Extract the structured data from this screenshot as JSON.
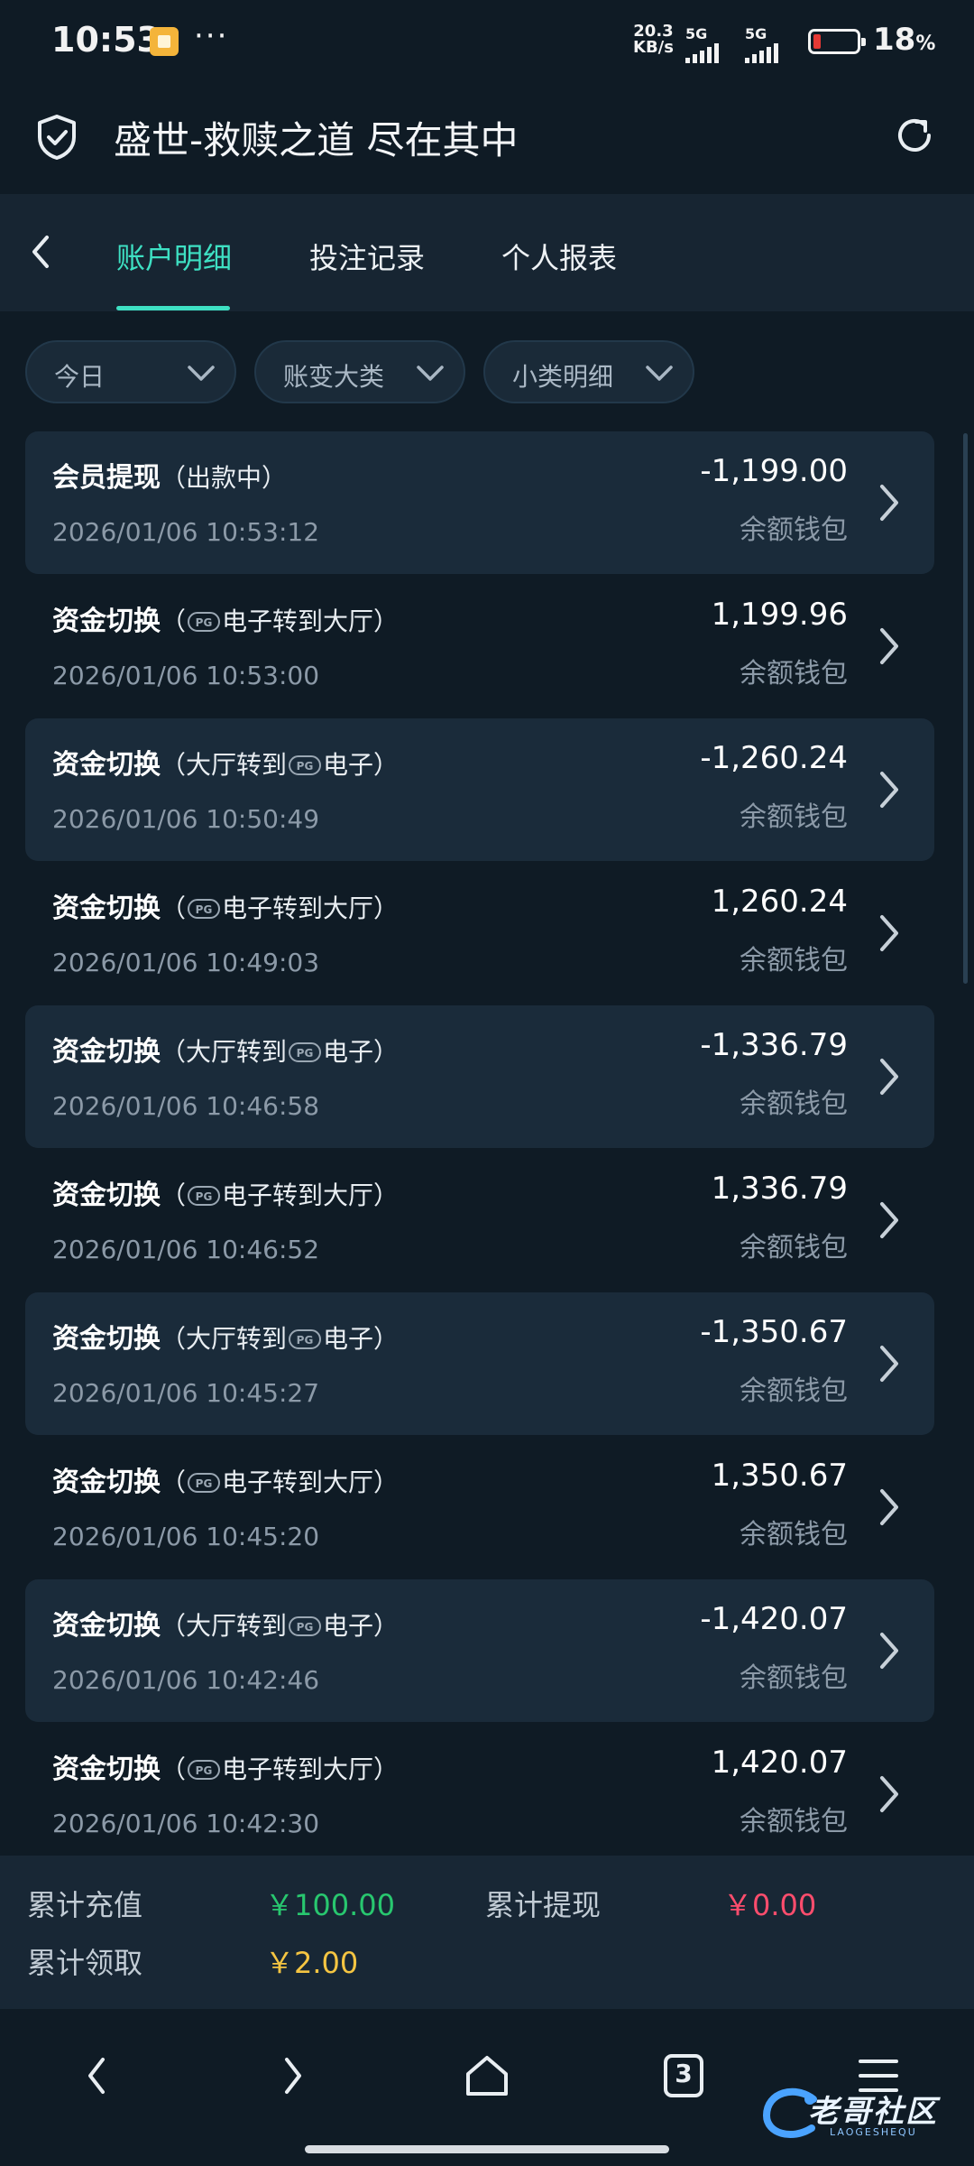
{
  "status_bar": {
    "time": "10:53",
    "more": "···",
    "net_speed_value": "20.3",
    "net_speed_unit": "KB/s",
    "signal1_label": "5G",
    "signal2_label": "5G",
    "battery_percent": "18",
    "battery_unit": "%"
  },
  "header": {
    "title": "盛世-救赎之道 尽在其中",
    "left_icon": "shield-check-icon",
    "right_icon": "refresh-icon"
  },
  "tabs": [
    {
      "label": "账户明细",
      "active": true
    },
    {
      "label": "投注记录",
      "active": false
    },
    {
      "label": "个人报表",
      "active": false
    }
  ],
  "filters": [
    {
      "label": "今日"
    },
    {
      "label": "账变大类"
    },
    {
      "label": "小类明细"
    }
  ],
  "records": [
    {
      "title": "会员提现",
      "detail_pre": "（出款中）",
      "detail_post": "",
      "has_logo": false,
      "time": "2026/01/06 10:53:12",
      "amount": "-1,199.00",
      "wallet": "余额钱包",
      "shaded": true
    },
    {
      "title": "资金切换",
      "detail_pre": "（",
      "detail_post": "电子转到大厅）",
      "has_logo": true,
      "time": "2026/01/06 10:53:00",
      "amount": "1,199.96",
      "wallet": "余额钱包",
      "shaded": false
    },
    {
      "title": "资金切换",
      "detail_pre": "（大厅转到",
      "detail_post": "电子）",
      "has_logo": true,
      "time": "2026/01/06 10:50:49",
      "amount": "-1,260.24",
      "wallet": "余额钱包",
      "shaded": true
    },
    {
      "title": "资金切换",
      "detail_pre": "（",
      "detail_post": "电子转到大厅）",
      "has_logo": true,
      "time": "2026/01/06 10:49:03",
      "amount": "1,260.24",
      "wallet": "余额钱包",
      "shaded": false
    },
    {
      "title": "资金切换",
      "detail_pre": "（大厅转到",
      "detail_post": "电子）",
      "has_logo": true,
      "time": "2026/01/06 10:46:58",
      "amount": "-1,336.79",
      "wallet": "余额钱包",
      "shaded": true
    },
    {
      "title": "资金切换",
      "detail_pre": "（",
      "detail_post": "电子转到大厅）",
      "has_logo": true,
      "time": "2026/01/06 10:46:52",
      "amount": "1,336.79",
      "wallet": "余额钱包",
      "shaded": false
    },
    {
      "title": "资金切换",
      "detail_pre": "（大厅转到",
      "detail_post": "电子）",
      "has_logo": true,
      "time": "2026/01/06 10:45:27",
      "amount": "-1,350.67",
      "wallet": "余额钱包",
      "shaded": true
    },
    {
      "title": "资金切换",
      "detail_pre": "（",
      "detail_post": "电子转到大厅）",
      "has_logo": true,
      "time": "2026/01/06 10:45:20",
      "amount": "1,350.67",
      "wallet": "余额钱包",
      "shaded": false
    },
    {
      "title": "资金切换",
      "detail_pre": "（大厅转到",
      "detail_post": "电子）",
      "has_logo": true,
      "time": "2026/01/06 10:42:46",
      "amount": "-1,420.07",
      "wallet": "余额钱包",
      "shaded": true
    },
    {
      "title": "资金切换",
      "detail_pre": "（",
      "detail_post": "电子转到大厅）",
      "has_logo": true,
      "time": "2026/01/06 10:42:30",
      "amount": "1,420.07",
      "wallet": "余额钱包",
      "shaded": false
    }
  ],
  "summary": {
    "recharge_label": "累计充值",
    "recharge_value": "￥100.00",
    "withdraw_label": "累计提现",
    "withdraw_value": "￥0.00",
    "claim_label": "累计领取",
    "claim_value": "￥2.00"
  },
  "colors": {
    "accent": "#3ee0c3",
    "recharge": "#28c76f",
    "withdraw": "#ff4d6d",
    "claim": "#f5c542"
  },
  "nav": {
    "tab_count": "3"
  },
  "watermark": {
    "text": "老哥社区",
    "sub": "LAOGESHEQU"
  }
}
